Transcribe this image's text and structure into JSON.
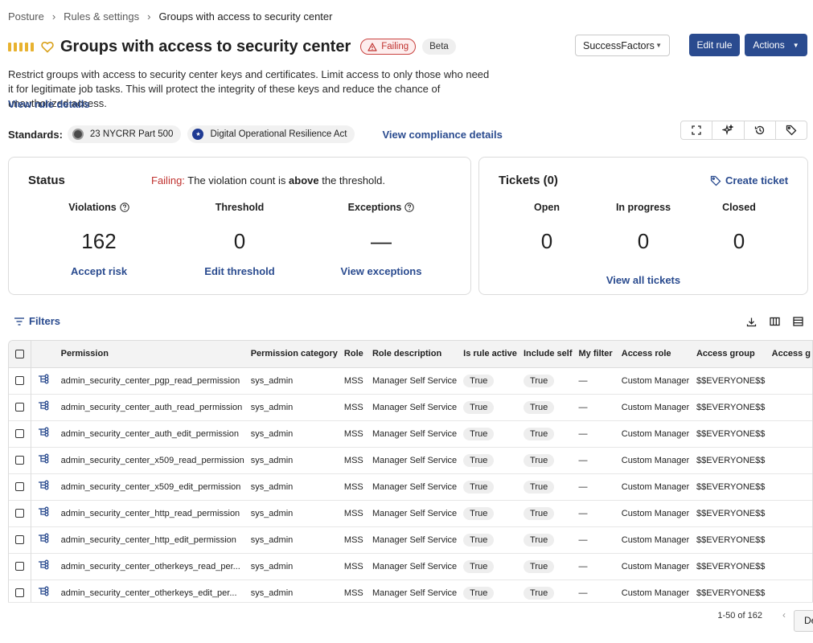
{
  "breadcrumb": [
    "Posture",
    "Rules & settings",
    "Groups with access to security center"
  ],
  "header": {
    "title": "Groups with access to security center",
    "failing_badge": "Failing",
    "beta_badge": "Beta",
    "instance_select": "SuccessFactors",
    "edit_rule": "Edit rule",
    "actions": "Actions"
  },
  "description": "Restrict groups with access to security center keys and certificates. Limit access to only those who need it for legitimate job tasks. This will protect the integrity of these keys and reduce the chance of unauthorized access.",
  "view_rule_details": "View rule details",
  "standards": {
    "label": "Standards:",
    "items": [
      "23 NYCRR Part 500",
      "Digital Operational Resilience Act"
    ],
    "view_compliance": "View compliance details"
  },
  "status": {
    "title": "Status",
    "msg_failing": "Failing:",
    "msg_part1": " The violation count is ",
    "msg_bold": "above",
    "msg_part2": " the threshold.",
    "violations_label": "Violations",
    "violations_value": "162",
    "accept_risk": "Accept risk",
    "threshold_label": "Threshold",
    "threshold_value": "0",
    "edit_threshold": "Edit threshold",
    "exceptions_label": "Exceptions",
    "exceptions_value": "—",
    "view_exceptions": "View exceptions"
  },
  "tickets": {
    "title": "Tickets (0)",
    "create": "Create ticket",
    "open_label": "Open",
    "open_value": "0",
    "in_progress_label": "In progress",
    "in_progress_value": "0",
    "closed_label": "Closed",
    "closed_value": "0",
    "view_all": "View all tickets"
  },
  "filters_label": "Filters",
  "table": {
    "columns": [
      "Permission",
      "Permission category",
      "Role",
      "Role description",
      "Is rule active",
      "Include self",
      "My filter",
      "Access role",
      "Access group",
      "Access g"
    ],
    "rows": [
      [
        "admin_security_center_pgp_read_permission",
        "sys_admin",
        "MSS",
        "Manager Self Service",
        "True",
        "True",
        "—",
        "Custom Manager",
        "$$EVERYONE$$"
      ],
      [
        "admin_security_center_auth_read_permission",
        "sys_admin",
        "MSS",
        "Manager Self Service",
        "True",
        "True",
        "—",
        "Custom Manager",
        "$$EVERYONE$$"
      ],
      [
        "admin_security_center_auth_edit_permission",
        "sys_admin",
        "MSS",
        "Manager Self Service",
        "True",
        "True",
        "—",
        "Custom Manager",
        "$$EVERYONE$$"
      ],
      [
        "admin_security_center_x509_read_permission",
        "sys_admin",
        "MSS",
        "Manager Self Service",
        "True",
        "True",
        "—",
        "Custom Manager",
        "$$EVERYONE$$"
      ],
      [
        "admin_security_center_x509_edit_permission",
        "sys_admin",
        "MSS",
        "Manager Self Service",
        "True",
        "True",
        "—",
        "Custom Manager",
        "$$EVERYONE$$"
      ],
      [
        "admin_security_center_http_read_permission",
        "sys_admin",
        "MSS",
        "Manager Self Service",
        "True",
        "True",
        "—",
        "Custom Manager",
        "$$EVERYONE$$"
      ],
      [
        "admin_security_center_http_edit_permission",
        "sys_admin",
        "MSS",
        "Manager Self Service",
        "True",
        "True",
        "—",
        "Custom Manager",
        "$$EVERYONE$$"
      ],
      [
        "admin_security_center_otherkeys_read_per...",
        "sys_admin",
        "MSS",
        "Manager Self Service",
        "True",
        "True",
        "—",
        "Custom Manager",
        "$$EVERYONE$$"
      ],
      [
        "admin_security_center_otherkeys_edit_per...",
        "sys_admin",
        "MSS",
        "Manager Self Service",
        "True",
        "True",
        "—",
        "Custom Manager",
        "$$EVERYONE$$"
      ]
    ]
  },
  "pagination": {
    "info": "1-50 of 162",
    "prev": "‹"
  },
  "floating_tab": "De",
  "colors": {
    "accent": "#2a4b8f",
    "failing": "#c0322f",
    "severity": "#e8b22f"
  },
  "icons": [
    "severity-bars-icon",
    "heart-icon",
    "warning-icon",
    "expand-icon",
    "sparkle-icon",
    "history-icon",
    "tag-icon",
    "help-icon",
    "filter-icon",
    "download-icon",
    "columns-icon",
    "density-icon",
    "relation-icon"
  ]
}
